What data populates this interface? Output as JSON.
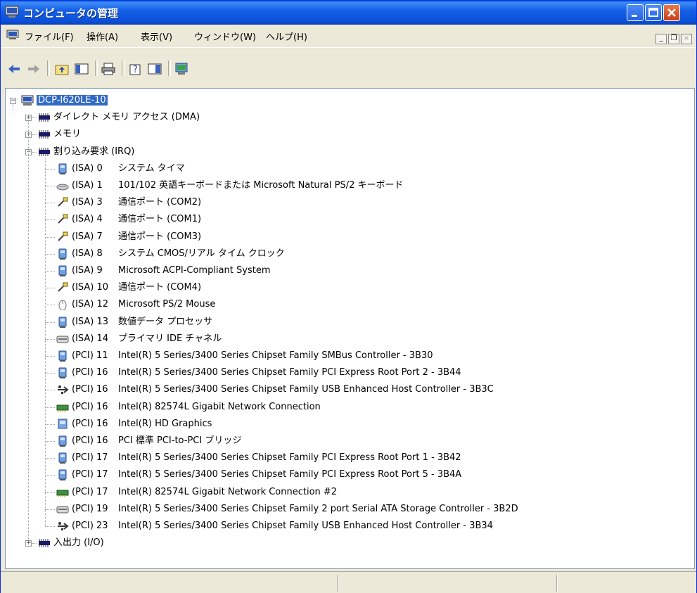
{
  "window": {
    "title": "コンピュータの管理"
  },
  "menu": {
    "items": [
      "ファイル(F)",
      "操作(A)",
      "表示(V)",
      "ウィンドウ(W)",
      "ヘルプ(H)"
    ]
  },
  "tree": {
    "root": "DCP-I620LE-10",
    "categories": [
      {
        "label": "ダイレクト メモリ アクセス (DMA)",
        "expander": "+"
      },
      {
        "label": "メモリ",
        "expander": "+"
      },
      {
        "label": "割り込み要求 (IRQ)",
        "expander": "−"
      },
      {
        "label": "入出力 (I/O)",
        "expander": "+"
      }
    ],
    "irq_items": [
      {
        "res": "(ISA) 0",
        "name": "システム タイマ",
        "icon": "system-device-icon"
      },
      {
        "res": "(ISA) 1",
        "name": "101/102 英語キーボードまたは Microsoft Natural PS/2 キーボード",
        "icon": "keyboard-icon"
      },
      {
        "res": "(ISA) 3",
        "name": "通信ポート (COM2)",
        "icon": "port-icon"
      },
      {
        "res": "(ISA) 4",
        "name": "通信ポート (COM1)",
        "icon": "port-icon"
      },
      {
        "res": "(ISA) 7",
        "name": "通信ポート (COM3)",
        "icon": "port-icon"
      },
      {
        "res": "(ISA) 8",
        "name": "システム CMOS/リアル タイム クロック",
        "icon": "system-device-icon"
      },
      {
        "res": "(ISA) 9",
        "name": "Microsoft ACPI-Compliant System",
        "icon": "system-device-icon"
      },
      {
        "res": "(ISA) 10",
        "name": "通信ポート (COM4)",
        "icon": "port-icon"
      },
      {
        "res": "(ISA) 12",
        "name": "Microsoft PS/2 Mouse",
        "icon": "mouse-icon"
      },
      {
        "res": "(ISA) 13",
        "name": "数値データ プロセッサ",
        "icon": "system-device-icon"
      },
      {
        "res": "(ISA) 14",
        "name": "プライマリ IDE チャネル",
        "icon": "ide-controller-icon"
      },
      {
        "res": "(PCI) 11",
        "name": "Intel(R) 5 Series/3400 Series Chipset Family SMBus Controller - 3B30",
        "icon": "system-device-icon"
      },
      {
        "res": "(PCI) 16",
        "name": "Intel(R) 5 Series/3400 Series Chipset Family PCI Express Root Port 2 - 3B44",
        "icon": "system-device-icon"
      },
      {
        "res": "(PCI) 16",
        "name": "Intel(R) 5 Series/3400 Series Chipset Family USB Enhanced Host Controller - 3B3C",
        "icon": "usb-icon"
      },
      {
        "res": "(PCI) 16",
        "name": "Intel(R) 82574L Gigabit Network Connection",
        "icon": "network-adapter-icon"
      },
      {
        "res": "(PCI) 16",
        "name": "Intel(R) HD Graphics",
        "icon": "display-adapter-icon"
      },
      {
        "res": "(PCI) 16",
        "name": "PCI 標準 PCI-to-PCI ブリッジ",
        "icon": "system-device-icon"
      },
      {
        "res": "(PCI) 17",
        "name": "Intel(R) 5 Series/3400 Series Chipset Family PCI Express Root Port 1 - 3B42",
        "icon": "system-device-icon"
      },
      {
        "res": "(PCI) 17",
        "name": "Intel(R) 5 Series/3400 Series Chipset Family PCI Express Root Port 5 - 3B4A",
        "icon": "system-device-icon"
      },
      {
        "res": "(PCI) 17",
        "name": "Intel(R) 82574L Gigabit Network Connection #2",
        "icon": "network-adapter-icon"
      },
      {
        "res": "(PCI) 19",
        "name": "Intel(R) 5 Series/3400 Series Chipset Family 2 port Serial ATA Storage Controller - 3B2D",
        "icon": "ide-controller-icon"
      },
      {
        "res": "(PCI) 23",
        "name": "Intel(R) 5 Series/3400 Series Chipset Family USB Enhanced Host Controller - 3B34",
        "icon": "usb-icon"
      }
    ]
  },
  "colors": {
    "titlebar": "#0a4fd6",
    "selection": "#316ac5",
    "chrome": "#ece9d8"
  }
}
